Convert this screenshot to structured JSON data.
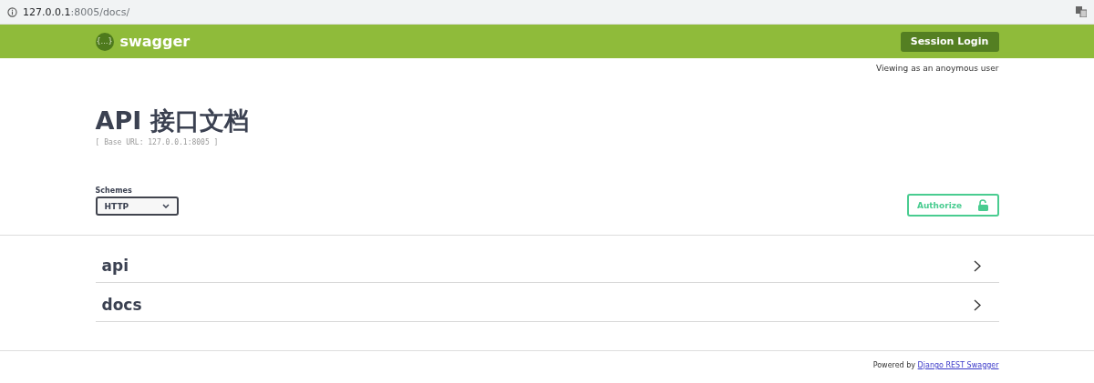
{
  "address_bar": {
    "url_host": "127.0.0.1",
    "url_rest": ":8005/docs/"
  },
  "topbar": {
    "brand": "swagger",
    "logo_glyph": "{…}",
    "login_button": "Session Login"
  },
  "user_note": "Viewing as an anoymous user",
  "info": {
    "title": "API 接口文档",
    "base_url": "[ Base URL: 127.0.0.1:8005 ]"
  },
  "schemes": {
    "label": "Schemes",
    "value": "HTTP"
  },
  "authorize_button": "Authorize",
  "sections": [
    {
      "name": "api",
      "expanded": false
    },
    {
      "name": "docs",
      "expanded": false
    }
  ],
  "footer": {
    "prefix": "Powered by",
    "link": "Django REST Swagger"
  }
}
